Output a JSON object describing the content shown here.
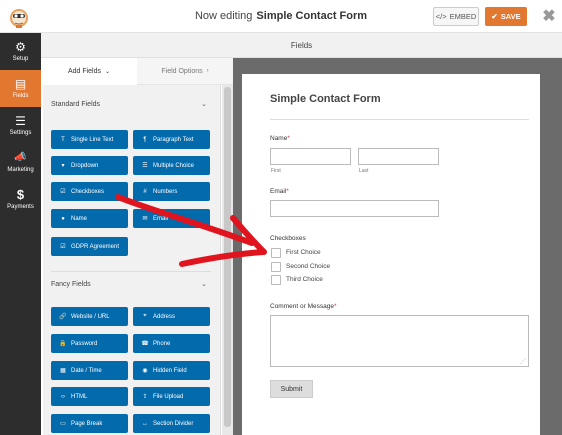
{
  "header": {
    "title_prefix": "Now editing",
    "form_name": "Simple Contact Form",
    "embed_label": "EMBED",
    "save_label": "SAVE",
    "close_glyph": "✖"
  },
  "nav": [
    {
      "label": "Setup",
      "icon": "gear-icon",
      "glyph": "⚙"
    },
    {
      "label": "Fields",
      "icon": "fields-icon",
      "glyph": "▤"
    },
    {
      "label": "Settings",
      "icon": "sliders-icon",
      "glyph": "☰"
    },
    {
      "label": "Marketing",
      "icon": "megaphone-icon",
      "glyph": "📣"
    },
    {
      "label": "Payments",
      "icon": "dollar-icon",
      "glyph": "$"
    }
  ],
  "fields_bar": {
    "title": "Fields"
  },
  "tabs": {
    "add_fields": "Add Fields",
    "field_options": "Field Options"
  },
  "standard_fields": {
    "title": "Standard Fields",
    "items": [
      {
        "label": "Single Line Text",
        "glyph": "T"
      },
      {
        "label": "Paragraph Text",
        "glyph": "¶"
      },
      {
        "label": "Dropdown",
        "glyph": "▾"
      },
      {
        "label": "Multiple Choice",
        "glyph": "☰"
      },
      {
        "label": "Checkboxes",
        "glyph": "☑"
      },
      {
        "label": "Numbers",
        "glyph": "#"
      },
      {
        "label": "Name",
        "glyph": "●"
      },
      {
        "label": "Email",
        "glyph": "✉"
      },
      {
        "label": "GDPR Agreement",
        "glyph": "☑"
      }
    ]
  },
  "fancy_fields": {
    "title": "Fancy Fields",
    "items": [
      {
        "label": "Website / URL",
        "glyph": "🔗"
      },
      {
        "label": "Address",
        "glyph": "⌖"
      },
      {
        "label": "Password",
        "glyph": "🔒"
      },
      {
        "label": "Phone",
        "glyph": "☎"
      },
      {
        "label": "Date / Time",
        "glyph": "▦"
      },
      {
        "label": "Hidden Field",
        "glyph": "◉"
      },
      {
        "label": "HTML",
        "glyph": "‹›"
      },
      {
        "label": "File Upload",
        "glyph": "⇪"
      },
      {
        "label": "Page Break",
        "glyph": "▭"
      },
      {
        "label": "Section Divider",
        "glyph": "↔"
      }
    ]
  },
  "form": {
    "title": "Simple Contact Form",
    "name_label": "Name",
    "first_label": "First",
    "last_label": "Last",
    "email_label": "Email",
    "checkboxes_label": "Checkboxes",
    "choices": [
      "First Choice",
      "Second Choice",
      "Third Choice"
    ],
    "comment_label": "Comment or Message",
    "required_mark": "*",
    "submit_label": "Submit"
  },
  "colors": {
    "accent_orange": "#e27730",
    "field_button_blue": "#036aab",
    "nav_dark": "#2d2d2d",
    "annotation_arrow_red": "#e0141e"
  }
}
